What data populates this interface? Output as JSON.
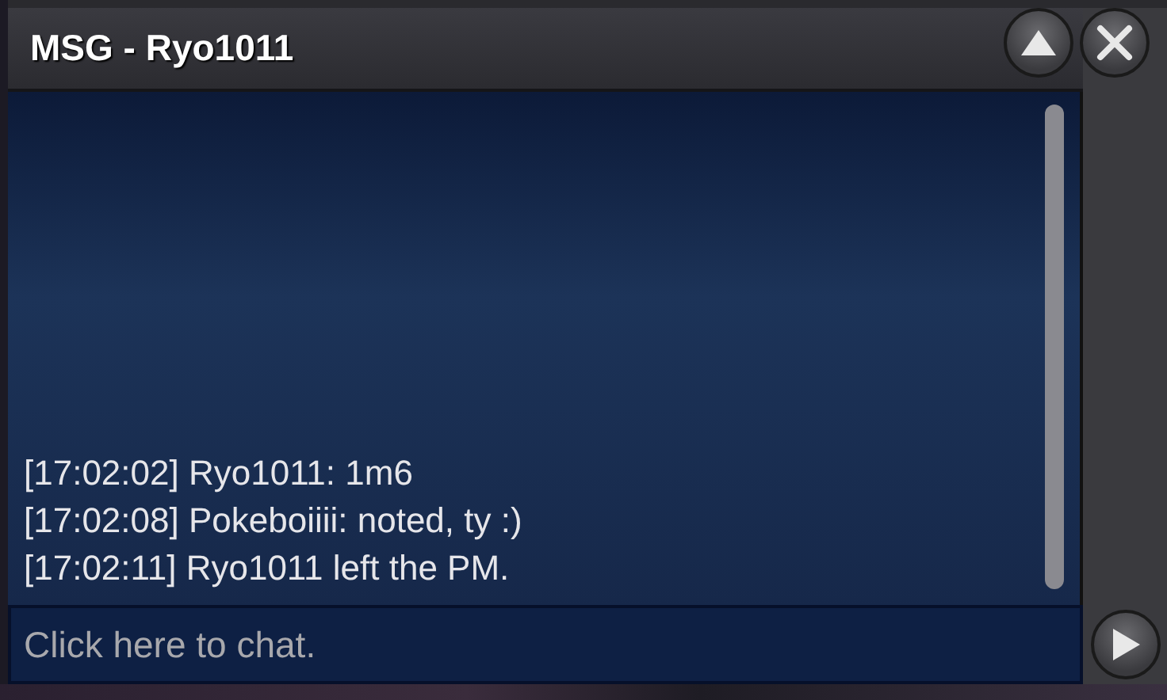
{
  "window": {
    "title": "MSG - Ryo1011"
  },
  "messages": [
    {
      "time": "[17:02:02]",
      "text": "Ryo1011: 1m6"
    },
    {
      "time": "[17:02:08]",
      "text": "Pokeboiiii: noted, ty :)"
    },
    {
      "time": "[17:02:11]",
      "text": "Ryo1011 left the PM."
    }
  ],
  "input": {
    "placeholder": "Click here to chat."
  }
}
